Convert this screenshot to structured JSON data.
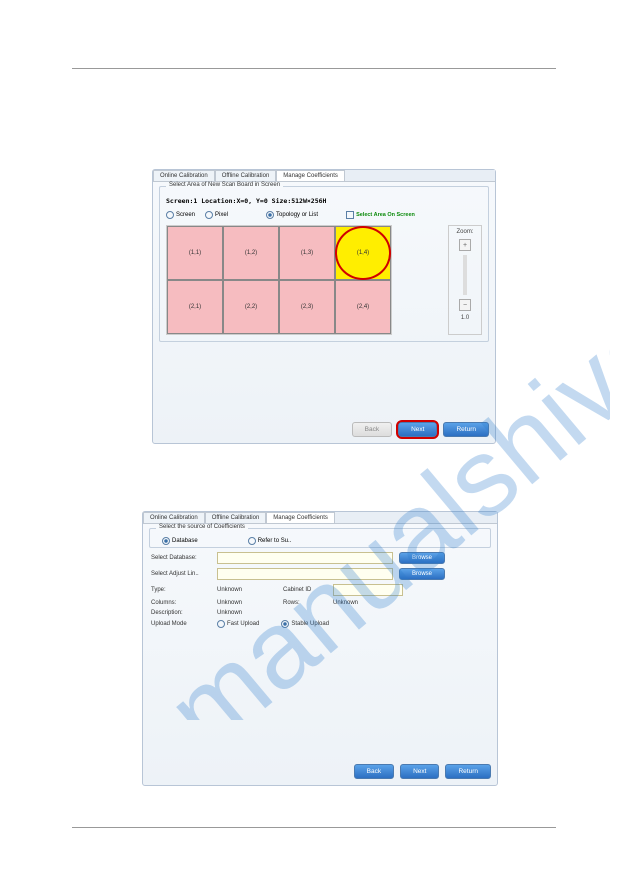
{
  "tabs": {
    "online": "Online Calibration",
    "offline": "Offline Calibration",
    "manage": "Manage Coefficients"
  },
  "win1": {
    "legend": "Select Area of New Scan Board in Screen",
    "info": "Screen:1  Location:X=0, Y=0   Size:512W×256H",
    "radio_screen": "Screen",
    "radio_pixel": "Pixel",
    "radio_topology": "Topology or List",
    "chk_select": "Select Area On\nScreen",
    "zoom_label": "Zoom:",
    "zoom_val": "1.0",
    "cells": [
      [
        "(1,1)",
        "(1,2)",
        "(1,3)",
        "(1,4)"
      ],
      [
        "(2,1)",
        "(2,2)",
        "(2,3)",
        "(2,4)"
      ]
    ],
    "selected": "(1,4)"
  },
  "win2": {
    "legend": "Select the source of Coefficients",
    "radio_db": "Database",
    "radio_refer": "Refer to Su..",
    "lbl_seldb": "Select Database:",
    "lbl_seladj": "Select Adjust Lin..",
    "lbl_type": "Type:",
    "lbl_cabinet": "Cabinet ID",
    "lbl_cols": "Columns:",
    "lbl_rows": "Rows:",
    "lbl_desc": "Description:",
    "lbl_upload": "Upload Mode",
    "val_unknown": "Unknown",
    "radio_fast": "Fast Upload",
    "radio_stable": "Stable Upload",
    "btn_browse": "Browse"
  },
  "buttons": {
    "back": "Back",
    "next": "Next",
    "return": "Return"
  }
}
